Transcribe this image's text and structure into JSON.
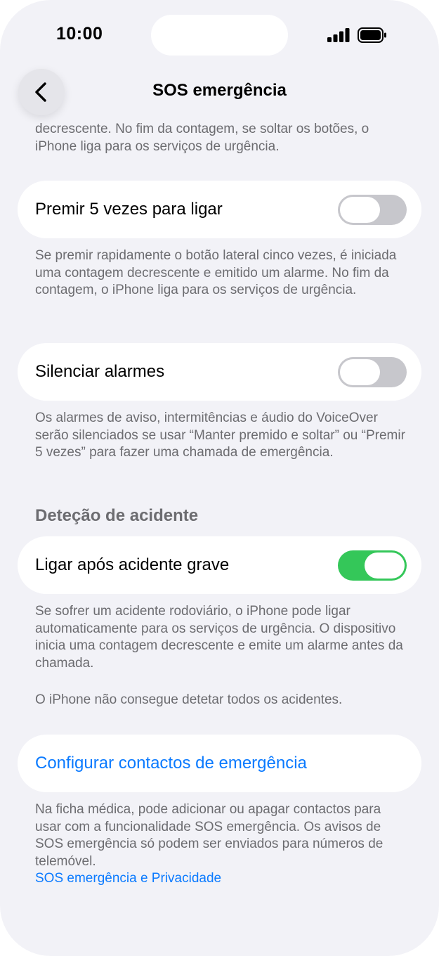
{
  "status_bar": {
    "time": "10:00"
  },
  "nav": {
    "title": "SOS emergência"
  },
  "intro_footer": "decrescente. No fim da contagem, se soltar os botões, o iPhone liga para os serviços de urgência.",
  "press5": {
    "label": "Premir 5 vezes para ligar",
    "enabled": false,
    "footer": "Se premir rapidamente o botão lateral cinco vezes, é iniciada uma contagem decrescente e emitido um alarme. No fim da contagem, o iPhone liga para os serviços de urgência."
  },
  "silence": {
    "label": "Silenciar alarmes",
    "enabled": false,
    "footer": "Os alarmes de aviso, intermitências e áudio do VoiceOver serão silenciados se usar “Manter premido e soltar” ou “Premir 5 vezes” para fazer uma chamada de emergência."
  },
  "crash": {
    "header": "Deteção de acidente",
    "label": "Ligar após acidente grave",
    "enabled": true,
    "footer1": "Se sofrer um acidente rodoviário, o iPhone pode ligar automaticamente para os serviços de urgência. O dispositivo inicia uma contagem decrescente e emite um alarme antes da chamada.",
    "footer2": "O iPhone não consegue detetar todos os acidentes."
  },
  "contacts": {
    "label": "Configurar contactos de emergência",
    "footer": "Na ficha médica, pode adicionar ou apagar contactos para usar com a funcionalidade SOS emergência. Os avisos de SOS emergência só podem ser enviados para números de telemóvel.",
    "privacy_link": "SOS emergência e Privacidade"
  },
  "colors": {
    "background": "#f2f2f7",
    "toggle_on": "#34c759",
    "toggle_off": "#c7c7cc",
    "link": "#0a7aff",
    "secondary_text": "#6c6c70"
  },
  "icons": [
    "back-chevron-icon",
    "signal-icon",
    "battery-icon"
  ]
}
